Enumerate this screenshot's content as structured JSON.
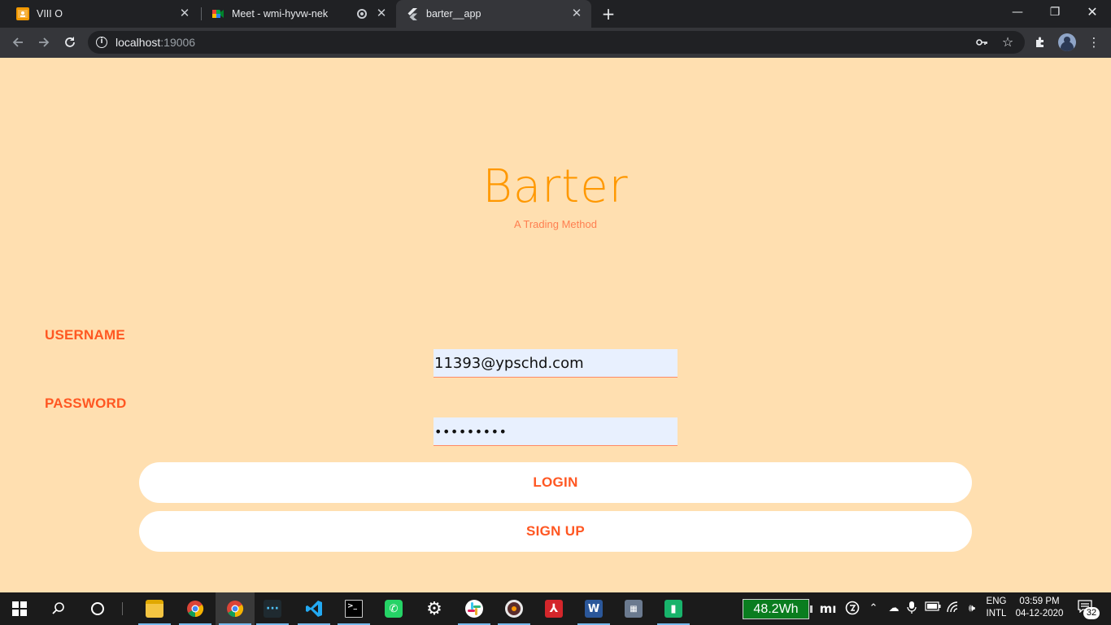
{
  "browser": {
    "tabs": [
      {
        "title": "VIII O",
        "favicon": "classroom-icon"
      },
      {
        "title": "Meet - wmi-hyvw-nek",
        "favicon": "meet-icon"
      },
      {
        "title": "barter__app",
        "favicon": "flutter-icon"
      }
    ],
    "url_host": "localhost",
    "url_port": ":19006"
  },
  "app": {
    "title": "Barter",
    "subtitle": "A Trading Method",
    "username_label": "USERNAME",
    "password_label": "PASSWORD",
    "username_value": "11393@ypschd.com",
    "password_value": "•••••••••",
    "login_label": "LOGIN",
    "signup_label": "SIGN UP"
  },
  "taskbar": {
    "battery": "48.2Wh",
    "lang_top": "ENG",
    "lang_bottom": "INTL",
    "time": "03:59 PM",
    "date": "04-12-2020",
    "notifications": "32"
  },
  "colors": {
    "page_bg": "#ffdfb0",
    "title": "#ff9800",
    "subtitle": "#ff7f50",
    "accent": "#ff5722",
    "field_bg": "#e8f0fe"
  }
}
